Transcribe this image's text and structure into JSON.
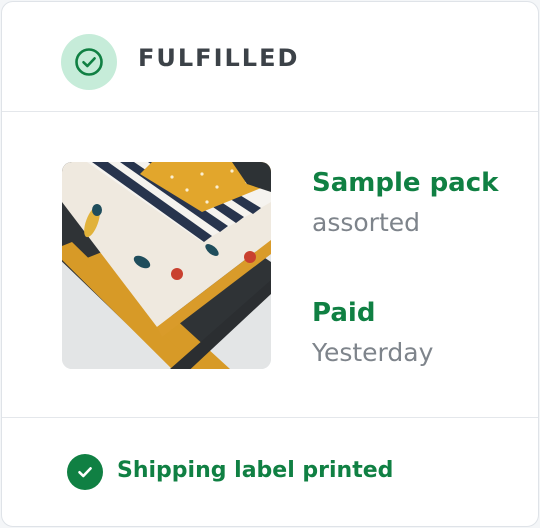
{
  "status": {
    "label": "FULFILLED",
    "icon": "check-circle-icon",
    "icon_bg_color": "#c6ecd9",
    "icon_color": "#108043"
  },
  "product": {
    "image_alt": "folded patterned fabric napkins",
    "title": "Sample pack",
    "subtitle": "assorted"
  },
  "payment": {
    "title": "Paid",
    "subtitle": "Yesterday"
  },
  "footer": {
    "icon": "check-circle-filled-icon",
    "label": "Shipping label printed"
  },
  "colors": {
    "accent_green": "#108043",
    "muted_text": "#7e848b",
    "heading_text": "#3c4248"
  }
}
